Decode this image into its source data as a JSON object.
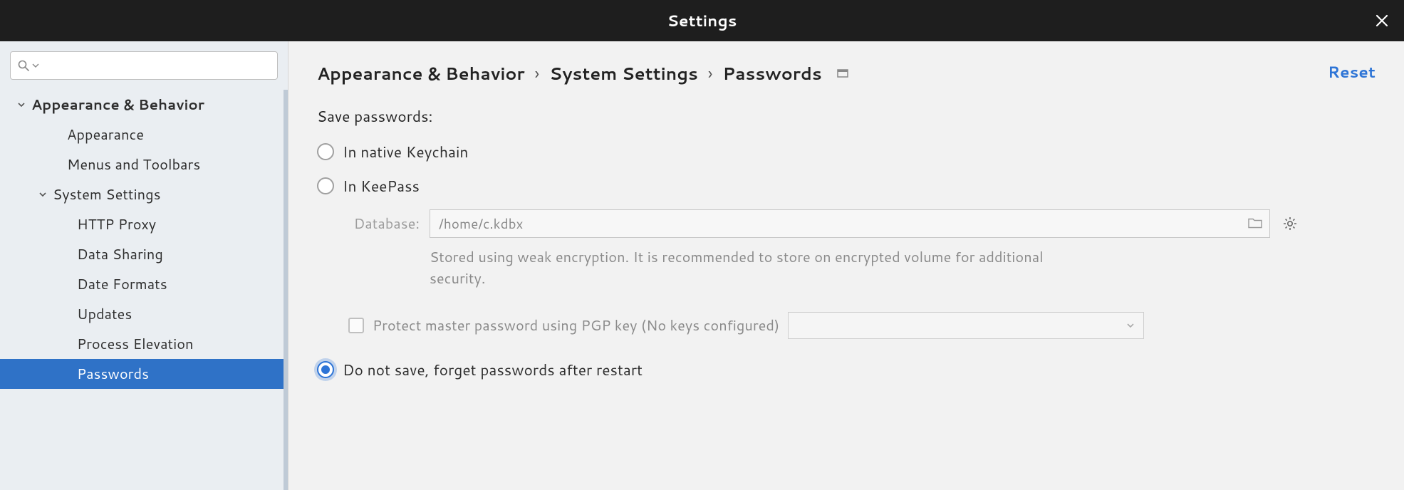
{
  "window": {
    "title": "Settings"
  },
  "search": {
    "placeholder": ""
  },
  "sidebar": {
    "items": [
      {
        "label": "Appearance & Behavior",
        "level": 0,
        "expanded": true,
        "bold": true
      },
      {
        "label": "Appearance",
        "level": 1
      },
      {
        "label": "Menus and Toolbars",
        "level": 1
      },
      {
        "label": "System Settings",
        "level": 1,
        "expanded": true
      },
      {
        "label": "HTTP Proxy",
        "level": 2
      },
      {
        "label": "Data Sharing",
        "level": 2
      },
      {
        "label": "Date Formats",
        "level": 2
      },
      {
        "label": "Updates",
        "level": 2
      },
      {
        "label": "Process Elevation",
        "level": 2
      },
      {
        "label": "Passwords",
        "level": 2,
        "selected": true
      }
    ]
  },
  "breadcrumb": {
    "parts": [
      "Appearance & Behavior",
      "System Settings",
      "Passwords"
    ]
  },
  "actions": {
    "reset": "Reset"
  },
  "passwords": {
    "heading": "Save passwords:",
    "native_keychain": "In native Keychain",
    "keepass": "In KeePass",
    "database_label": "Database:",
    "database_path": "/home/c.kdbx",
    "encryption_hint": "Stored using weak encryption. It is recommended to store on encrypted volume for additional security.",
    "protect_pgp": "Protect master password using PGP key (No keys configured)",
    "do_not_save": "Do not save, forget passwords after restart",
    "selected": "do_not_save"
  }
}
